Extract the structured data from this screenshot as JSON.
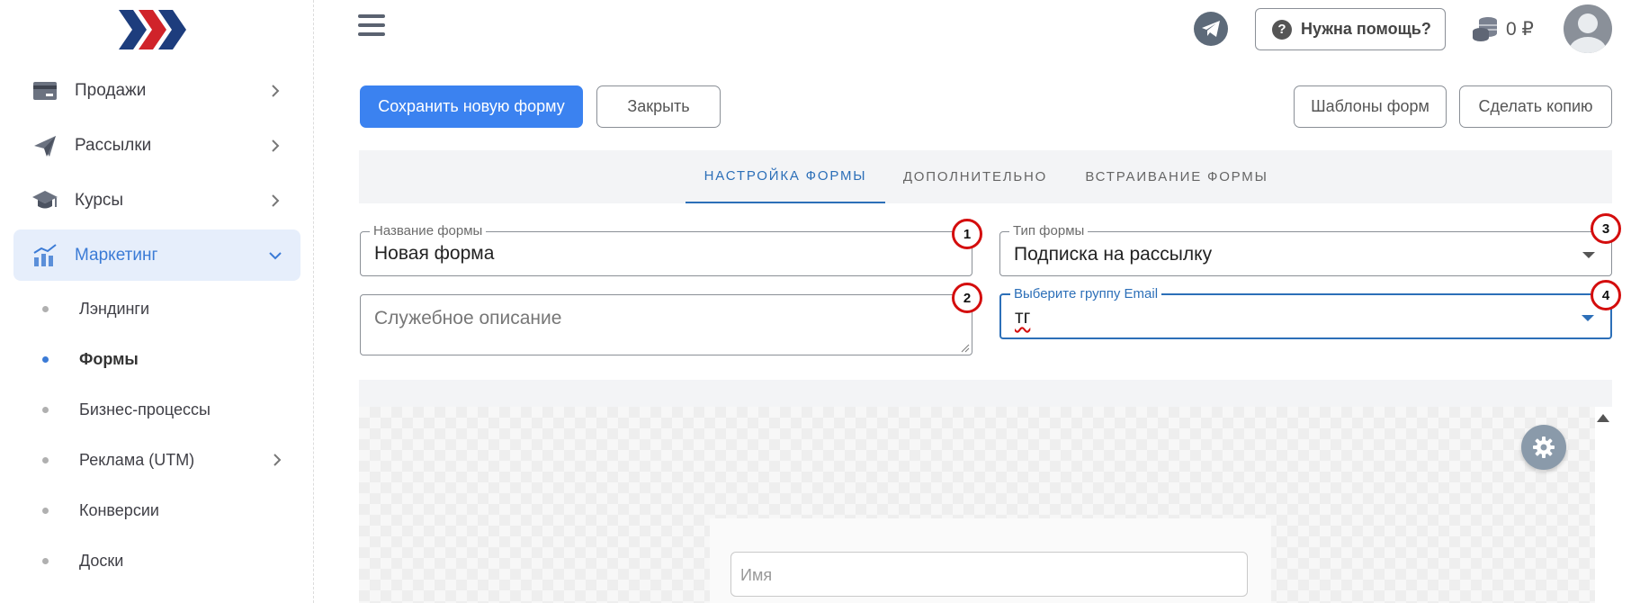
{
  "sidebar": {
    "items": [
      {
        "label": "Продажи",
        "icon": "credit-card-icon"
      },
      {
        "label": "Рассылки",
        "icon": "paper-plane-icon"
      },
      {
        "label": "Курсы",
        "icon": "graduation-cap-icon"
      },
      {
        "label": "Маркетинг",
        "icon": "bar-chart-icon"
      }
    ],
    "subitems": [
      {
        "label": "Лэндинги"
      },
      {
        "label": "Формы"
      },
      {
        "label": "Бизнес-процессы"
      },
      {
        "label": "Реклама (UTM)"
      },
      {
        "label": "Конверсии"
      },
      {
        "label": "Доски"
      }
    ]
  },
  "header": {
    "help_label": "Нужна помощь?",
    "balance_label": "0 ₽"
  },
  "toolbar": {
    "save_label": "Сохранить новую форму",
    "close_label": "Закрыть",
    "templates_label": "Шаблоны форм",
    "copy_label": "Сделать копию"
  },
  "tabs": [
    {
      "label": "НАСТРОЙКА ФОРМЫ"
    },
    {
      "label": "ДОПОЛНИТЕЛЬНО"
    },
    {
      "label": "ВСТРАИВАНИЕ ФОРМЫ"
    }
  ],
  "form": {
    "name_legend": "Название формы",
    "name_value": "Новая форма",
    "description_placeholder": "Служебное описание",
    "type_legend": "Тип формы",
    "type_value": "Подписка на рассылку",
    "group_legend": "Выберите группу Email",
    "group_value": "тг"
  },
  "markers": [
    "1",
    "2",
    "3",
    "4"
  ],
  "preview": {
    "name_placeholder": "Имя"
  },
  "colors": {
    "accent": "#3b82f0",
    "tab_active": "#2c6fb8",
    "marker": "#d40d0d"
  }
}
